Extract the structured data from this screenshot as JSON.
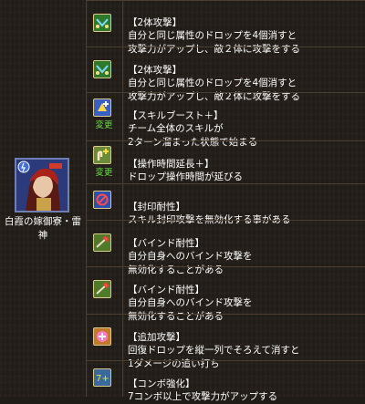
{
  "character": {
    "name": "白霞の嫁御寮・雷神"
  },
  "skills": [
    {
      "title": "【2体攻撃】",
      "desc": "自分と同じ属性のドロップを4個消すと\n攻撃力がアップし、敵２体に攻撃をする",
      "icon": "two-target-attack-icon",
      "change": ""
    },
    {
      "title": "【2体攻撃】",
      "desc": "自分と同じ属性のドロップを4個消すと\n攻撃力がアップし、敵２体に攻撃をする",
      "icon": "two-target-attack-icon",
      "change": ""
    },
    {
      "title": "【スキルブースト＋】",
      "desc": "チーム全体のスキルが\n2ターン溜まった状態で始まる",
      "icon": "skill-boost-plus-icon",
      "change": "変更"
    },
    {
      "title": "【操作時間延長＋】",
      "desc": "ドロップ操作時間が延びる",
      "icon": "time-extend-plus-icon",
      "change": "変更"
    },
    {
      "title": "【封印耐性】",
      "desc": "スキル封印攻撃を無効化する事がある",
      "icon": "seal-resist-icon",
      "change": ""
    },
    {
      "title": "【バインド耐性】",
      "desc": "自分自身へのバインド攻撃を\n無効化することがある",
      "icon": "bind-resist-icon",
      "change": ""
    },
    {
      "title": "【バインド耐性】",
      "desc": "自分自身へのバインド攻撃を\n無効化することがある",
      "icon": "bind-resist-icon",
      "change": ""
    },
    {
      "title": "【追加攻撃】",
      "desc": "回復ドロップを縦一列でそろえて消すと\n1ダメージの追い打ち",
      "icon": "extra-attack-icon",
      "change": ""
    },
    {
      "title": "【コンボ強化】",
      "desc": "7コンボ以上で攻撃力がアップする",
      "icon": "combo-boost-icon",
      "change": ""
    }
  ]
}
